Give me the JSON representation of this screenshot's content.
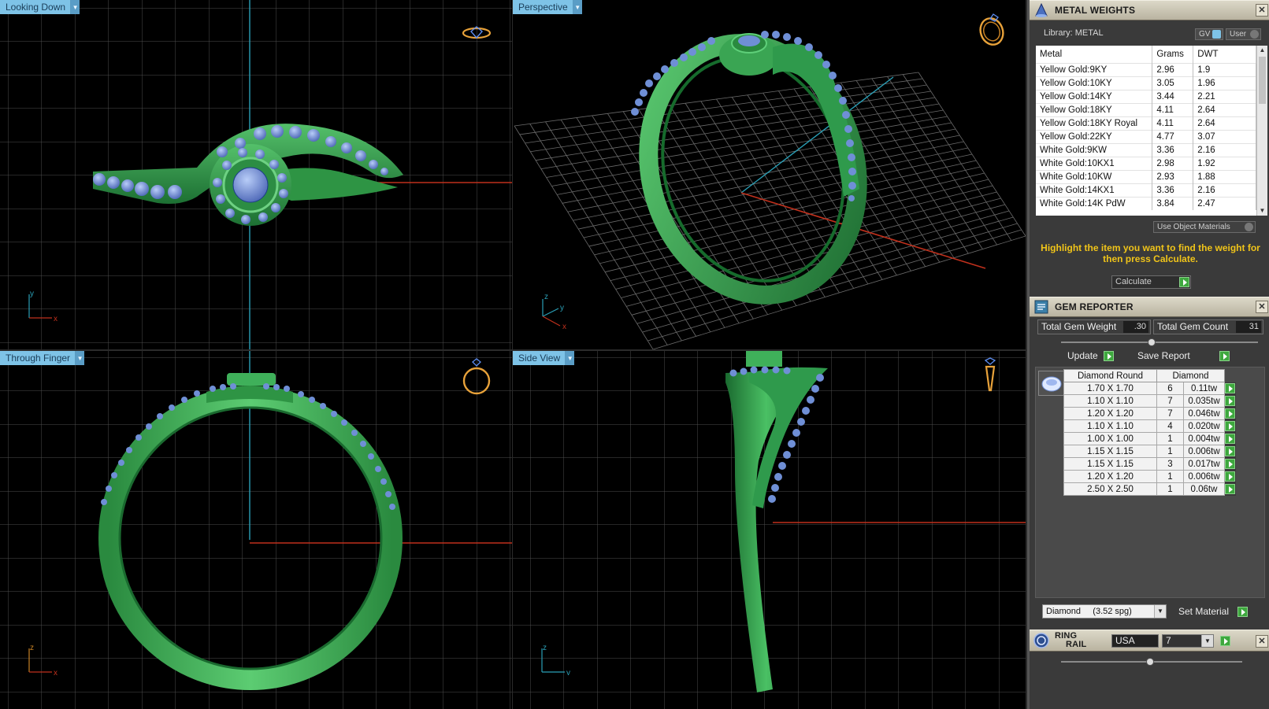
{
  "viewports": {
    "top_left": {
      "label": "Looking Down",
      "axis1": "y",
      "axis2": "x"
    },
    "top_right": {
      "label": "Perspective",
      "axis1": "z",
      "axis2": "y",
      "axis3": "x"
    },
    "bottom_left": {
      "label": "Through Finger",
      "axis1": "z",
      "axis2": "x"
    },
    "bottom_right": {
      "label": "Side View",
      "axis1": "z",
      "axis2": "y"
    }
  },
  "colors": {
    "ring": "#2f9a4c",
    "gem": "#6f8fd6",
    "viewport_label": "#7ec3e7",
    "grid": "#555555",
    "axis_red": "#c0301c",
    "axis_cyan": "#2a9fb6",
    "accent_text": "#f0c419"
  },
  "icons": {
    "metal_weights": "cone-icon",
    "gem_reporter": "gem-report-icon",
    "ring_rail": "ring-rail-icon",
    "close": "close-icon",
    "go": "play-arrow-icon"
  },
  "metal_weights": {
    "title": "METAL WEIGHTS",
    "library": "Library: METAL",
    "gv_label": "GV",
    "user_label": "User",
    "columns": [
      "Metal",
      "Grams",
      "DWT"
    ],
    "rows": [
      [
        "Yellow Gold:9KY",
        "2.96",
        "1.9"
      ],
      [
        "Yellow Gold:10KY",
        "3.05",
        "1.96"
      ],
      [
        "Yellow Gold:14KY",
        "3.44",
        "2.21"
      ],
      [
        "Yellow Gold:18KY",
        "4.11",
        "2.64"
      ],
      [
        "Yellow Gold:18KY Royal",
        "4.11",
        "2.64"
      ],
      [
        "Yellow Gold:22KY",
        "4.77",
        "3.07"
      ],
      [
        "White Gold:9KW",
        "3.36",
        "2.16"
      ],
      [
        "White Gold:10KX1",
        "2.98",
        "1.92"
      ],
      [
        "White Gold:10KW",
        "2.93",
        "1.88"
      ],
      [
        "White Gold:14KX1",
        "3.36",
        "2.16"
      ],
      [
        "White Gold:14K PdW",
        "3.84",
        "2.47"
      ]
    ],
    "use_object_materials": "Use Object Materials",
    "hint": "Highlight the item you want to find the weight for then press Calculate.",
    "calculate": "Calculate"
  },
  "gem_reporter": {
    "title": "GEM REPORTER",
    "total_weight_label": "Total Gem Weight",
    "total_weight": ".30",
    "total_count_label": "Total Gem Count",
    "total_count": "31",
    "update": "Update",
    "save_report": "Save Report",
    "columns": [
      "Diamond Round",
      "Diamond"
    ],
    "rows": [
      [
        "1.70 X 1.70",
        "6",
        "0.11tw"
      ],
      [
        "1.10 X 1.10",
        "7",
        "0.035tw"
      ],
      [
        "1.20 X 1.20",
        "7",
        "0.046tw"
      ],
      [
        "1.10 X 1.10",
        "4",
        "0.020tw"
      ],
      [
        "1.00 X 1.00",
        "1",
        "0.004tw"
      ],
      [
        "1.15 X 1.15",
        "1",
        "0.006tw"
      ],
      [
        "1.15 X 1.15",
        "3",
        "0.017tw"
      ],
      [
        "1.20 X 1.20",
        "1",
        "0.006tw"
      ],
      [
        "2.50 X 2.50",
        "1",
        "0.06tw"
      ]
    ],
    "material_select": "Diamond     (3.52 spg)",
    "set_material": "Set Material"
  },
  "ring_rail": {
    "title_line1": "RING",
    "title_line2": "RAIL",
    "region": "USA",
    "size": "7"
  }
}
